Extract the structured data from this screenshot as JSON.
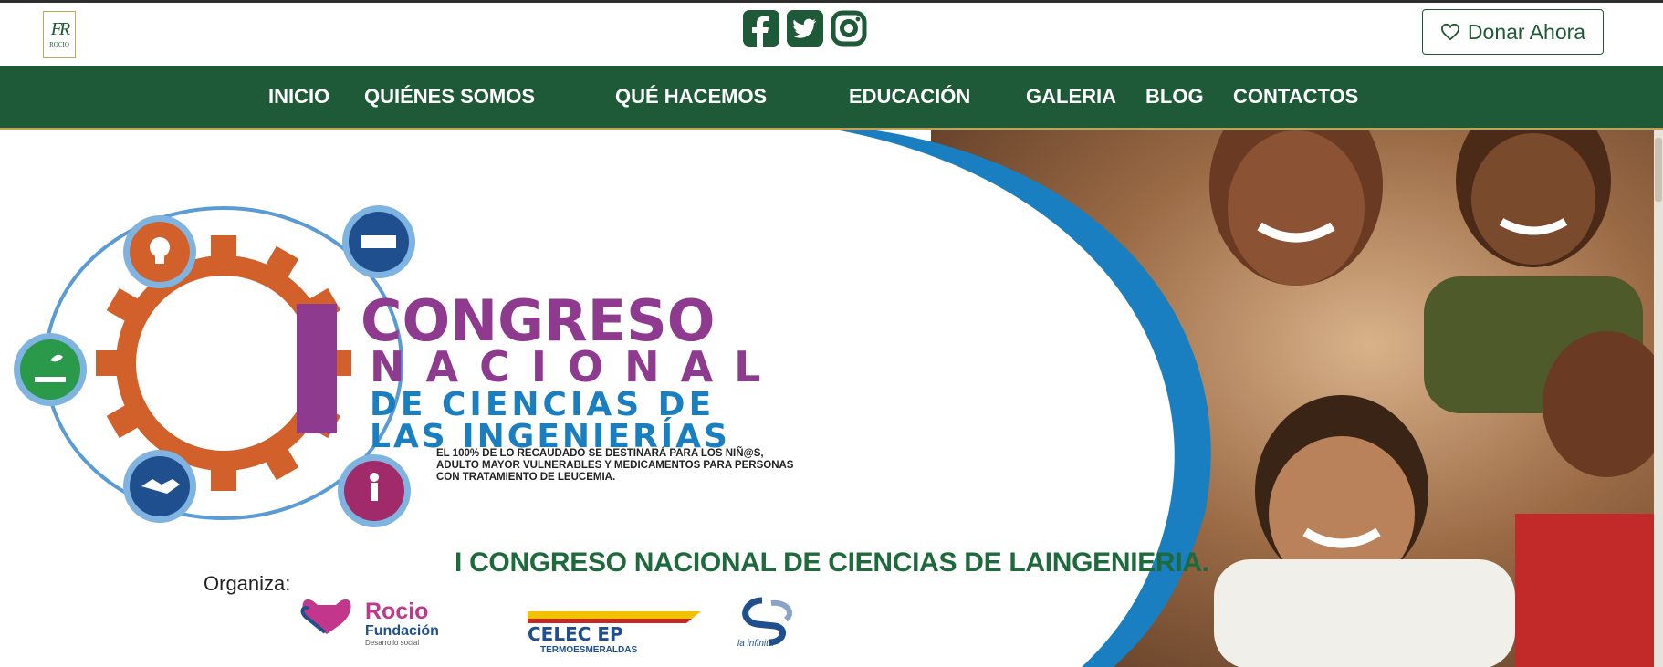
{
  "brand": {
    "logo_monogram": "FR",
    "logo_name": "ROCIO"
  },
  "social": [
    {
      "icon": "facebook-icon"
    },
    {
      "icon": "twitter-icon"
    },
    {
      "icon": "instagram-icon"
    }
  ],
  "donate": {
    "label": "Donar Ahora",
    "icon": "heart-icon"
  },
  "nav": {
    "items": [
      "INICIO",
      "QUIÉNES SOMOS",
      "QUÉ HACEMOS",
      "EDUCACIÓN",
      "GALERIA",
      "BLOG",
      "CONTACTOS"
    ]
  },
  "hero": {
    "poster": {
      "line1": "CONGRESO",
      "line2": "NACIONAL",
      "line3": "DE CIENCIAS DE",
      "line4": "LAS INGENIERÍAS",
      "numeral": "I",
      "note1": "EL 100% DE LO RECAUDADO SE DESTINARÁ PARA LOS NIÑ@S,",
      "note2": "ADULTO MAYOR VULNERABLES Y MEDICAMENTOS PARA PERSONAS",
      "note3": "CON TRATAMIENTO DE LEUCEMIA.",
      "organiza": "Organiza:",
      "sponsor1_a": "Rocio",
      "sponsor1_b": "Fundación",
      "sponsor1_c": "Desarrollo social",
      "sponsor2_a": "CELEC EP",
      "sponsor2_b": "TERMOESMERALDAS",
      "sponsor3": "la infinita"
    },
    "headline": "I CONGRESO NACIONAL DE CIENCIAS DE LAINGENIERIA.",
    "next_icon": "chevron-right-icon",
    "colors": {
      "purple": "#8e3a8e",
      "blue": "#1a7fc1",
      "orange": "#d2602a",
      "green": "#1e6a3c",
      "navy": "#1f4f8e"
    }
  }
}
